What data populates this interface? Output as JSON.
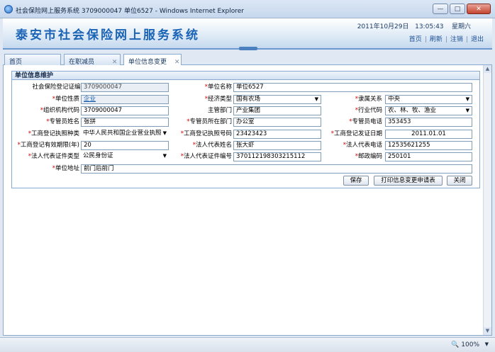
{
  "window": {
    "title": "社会保险网上服务系统  3709000047  单位6527 - Windows Internet Explorer",
    "min": "—",
    "max": "□",
    "close": "✕"
  },
  "header": {
    "app_title": "泰安市社会保险网上服务系统",
    "date": "2011年10月29日",
    "time": "13:05:43",
    "weekday": "星期六",
    "links": [
      "首页",
      "刷新",
      "注销",
      "退出"
    ]
  },
  "tabs": [
    {
      "label": "首页"
    },
    {
      "label": "在职减员",
      "close": "✕"
    },
    {
      "label": "单位信息变更",
      "close": "✕"
    }
  ],
  "panel_title": "单位信息维护",
  "form": {
    "row1": {
      "reg_code_label": "社会保险登记证编码",
      "reg_code": "3709000047",
      "unit_name_label": "单位名称",
      "unit_name": "单位6527"
    },
    "row2": {
      "unit_type_label": "单位性质",
      "unit_type": "企业",
      "econ_type_label": "经济类型",
      "econ_type": "国有农场",
      "affiliation_label": "隶属关系",
      "affiliation": "中央"
    },
    "row3": {
      "org_code_label": "组织机构代码",
      "org_code": "3709000047",
      "dept_label": "主管部门",
      "dept": "产业集团",
      "industry_label": "行业代码",
      "industry": "农、林、牧、渔业"
    },
    "row4": {
      "manager_name_label": "专管员姓名",
      "manager_name": "张拼",
      "manager_dept_label": "专管员所在部门",
      "manager_dept": "办公室",
      "manager_phone_label": "专管员电话",
      "manager_phone": "353453"
    },
    "row5": {
      "license_type_label": "工商登记执照种类",
      "license_type": "中华人民共和国企业营业执照",
      "license_no_label": "工商登记执照号码",
      "license_no": "23423423",
      "issue_date_label": "工商登记发证日期",
      "issue_date": "2011.01.01"
    },
    "row6": {
      "valid_years_label": "工商登记有效期限(年)",
      "valid_years": "20",
      "legal_name_label": "法人代表姓名",
      "legal_name": "张大虾",
      "legal_phone_label": "法人代表电话",
      "legal_phone": "12535621255"
    },
    "row7": {
      "id_type_label": "法人代表证件类型",
      "id_type": "公民身份证",
      "id_no_label": "法人代表证件编号",
      "id_no": "370112198303215112",
      "postcode_label": "邮政编码",
      "postcode": "250101"
    },
    "row8": {
      "address_label": "单位地址",
      "address": "前门后前门"
    },
    "required_mark": "*",
    "dropdown_glyph": "▼"
  },
  "buttons": {
    "save": "保存",
    "print": "打印信息变更申请表",
    "close": "关闭"
  },
  "status": {
    "zoom": "100%"
  }
}
